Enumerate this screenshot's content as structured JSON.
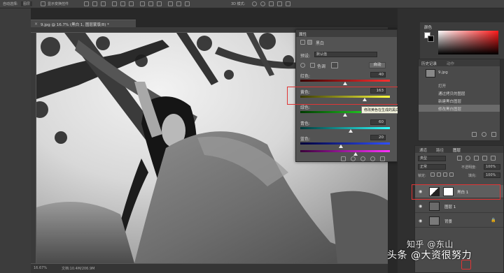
{
  "options_bar": {
    "select_label": "自动选择:",
    "select_value": "图层",
    "show_transform": "显示变换控件",
    "mode_3d": "3D 模式:"
  },
  "document": {
    "tab_title": "9.jpg @ 16.7% (黑白 1, 图层蒙版/8) *",
    "zoom": "16.67%",
    "doc_size": "文档:10.4M/206.9M"
  },
  "properties": {
    "title": "属性",
    "mode_label": "黑白",
    "preset_label": "预设:",
    "preset_value": "默认值",
    "tint_label": "色调",
    "auto_label": "自动",
    "sliders": [
      {
        "label": "红色:",
        "value": "40",
        "percent": 0.5
      },
      {
        "label": "黄色:",
        "value": "163",
        "percent": 0.72
      },
      {
        "label": "绿色:",
        "value": "",
        "percent": 0.5
      },
      {
        "label": "青色:",
        "value": "60",
        "percent": 0.56
      },
      {
        "label": "蓝色:",
        "value": "20",
        "percent": 0.45
      },
      {
        "label": "洋红:",
        "value": "",
        "percent": 0.62
      }
    ],
    "tooltip": "修改黄色在生成的黑白图像中的影响"
  },
  "color_panel": {
    "tab": "颜色"
  },
  "history": {
    "tabs": [
      "历史记录",
      "动作"
    ],
    "snapshot": "9.jpg",
    "items": [
      "打开",
      "通过拷贝的图层",
      "新建黑白图层",
      "修改黑白图层"
    ]
  },
  "layers": {
    "tabs": [
      "通道",
      "路径",
      "图层"
    ],
    "kind_filter": "类型",
    "blend_mode": "正常",
    "opacity_label": "不透明度:",
    "opacity_value": "100%",
    "lock_label": "锁定:",
    "fill_label": "填充:",
    "fill_value": "100%",
    "items": [
      {
        "name": "黑白 1",
        "selected": true
      },
      {
        "name": "图层 1",
        "selected": false
      },
      {
        "name": "背景",
        "selected": false
      }
    ]
  },
  "watermark": "头条 @大资很努力",
  "watermark_logo": "知乎 @东山",
  "colors": {
    "highlight": "#e03535",
    "panel_bg": "#535353"
  }
}
